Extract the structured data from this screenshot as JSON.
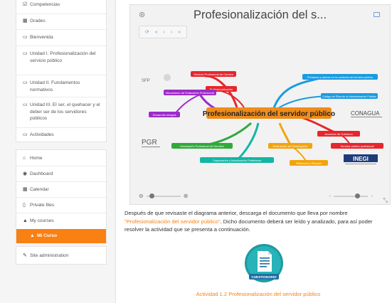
{
  "sidebar": {
    "course_items": [
      {
        "icon": "badge-icon",
        "glyph": "☑",
        "label": "Competencias"
      },
      {
        "icon": "grades-icon",
        "glyph": "▦",
        "label": "Grades"
      },
      {
        "icon": "folder-icon",
        "glyph": "▭",
        "label": "Bienvenida"
      },
      {
        "icon": "folder-icon",
        "glyph": "▭",
        "label": "Unidad I. Profesionalización del servicio público"
      },
      {
        "icon": "folder-icon",
        "glyph": "▭",
        "label": "Unidad II. Fundamentos normativos"
      },
      {
        "icon": "folder-icon",
        "glyph": "▭",
        "label": "Unidad III. El ser, el quehacer y el deber ser de los servidores públicos"
      },
      {
        "icon": "folder-icon",
        "glyph": "▭",
        "label": "Actividades"
      }
    ],
    "nav_items": [
      {
        "icon": "home-icon",
        "glyph": "⌂",
        "label": "Home"
      },
      {
        "icon": "dashboard-icon",
        "glyph": "◉",
        "label": "Dashboard"
      },
      {
        "icon": "calendar-icon",
        "glyph": "▦",
        "label": "Calendar"
      },
      {
        "icon": "file-icon",
        "glyph": "▯",
        "label": "Private files"
      },
      {
        "icon": "graduation-cap-icon",
        "glyph": "▲",
        "label": "My courses"
      },
      {
        "icon": "graduation-cap-icon",
        "glyph": "▲",
        "label": "Mi Curso"
      }
    ],
    "admin_item": {
      "icon": "wrench-icon",
      "glyph": "✎",
      "label": "Site administration"
    }
  },
  "viewer": {
    "title": "Profesionalización del s...",
    "toolbar_glyphs": [
      "⟳",
      "«",
      "‹",
      "›",
      "»"
    ],
    "zoom_in_glyph": "⊕",
    "zoom_out_glyph": "⊖",
    "expand_glyph": "⤡"
  },
  "mindmap": {
    "central": "Profesionalización del servidor público",
    "nodes": [
      {
        "text": "Servicio Profesional de Carrera",
        "color": "#e6262d"
      },
      {
        "text": "Profesionalización",
        "color": "#e6262d"
      },
      {
        "text": "Mecanismo de Evaluación Profesional",
        "color": "#9c2cc8"
      },
      {
        "text": "Desarrollo Integral",
        "color": "#9c2cc8"
      },
      {
        "text": "Principios y valores en la conducta del servidor público",
        "color": "#1b9be0"
      },
      {
        "text": "Código de Ética de la Administración Pública",
        "color": "#1b9be0"
      },
      {
        "text": "Acciones de Gobierno",
        "color": "#e6262d"
      },
      {
        "text": "Servidor público profesional",
        "color": "#e6262d"
      },
      {
        "text": "Desempeño Profesional del Servidor",
        "color": "#2faa3a"
      },
      {
        "text": "Capacitación y Actualización Profesional",
        "color": "#12b6a4"
      },
      {
        "text": "Evaluación del Desempeño",
        "color": "#f2a40c"
      },
      {
        "text": "Eficiencia y Eficacia",
        "color": "#f2a40c"
      }
    ],
    "logos": [
      "SFP",
      "CONAGUA",
      "PGR",
      "INEGI"
    ]
  },
  "content": {
    "paragraph_part1": "Después de que revisaste el diagrama anterior, descarga el documento que lleva por nombre",
    "paragraph_link": "\"Profesionalización del servidor público\"",
    "paragraph_part2": ". Dicho documento deberá ser leído y analizado, para así poder resolver la actividad que se presenta a continuación.",
    "quiz_label": "CUESTIONARIO",
    "activity_link": "Actividad 1.2 Profesionalización del servidor público"
  }
}
